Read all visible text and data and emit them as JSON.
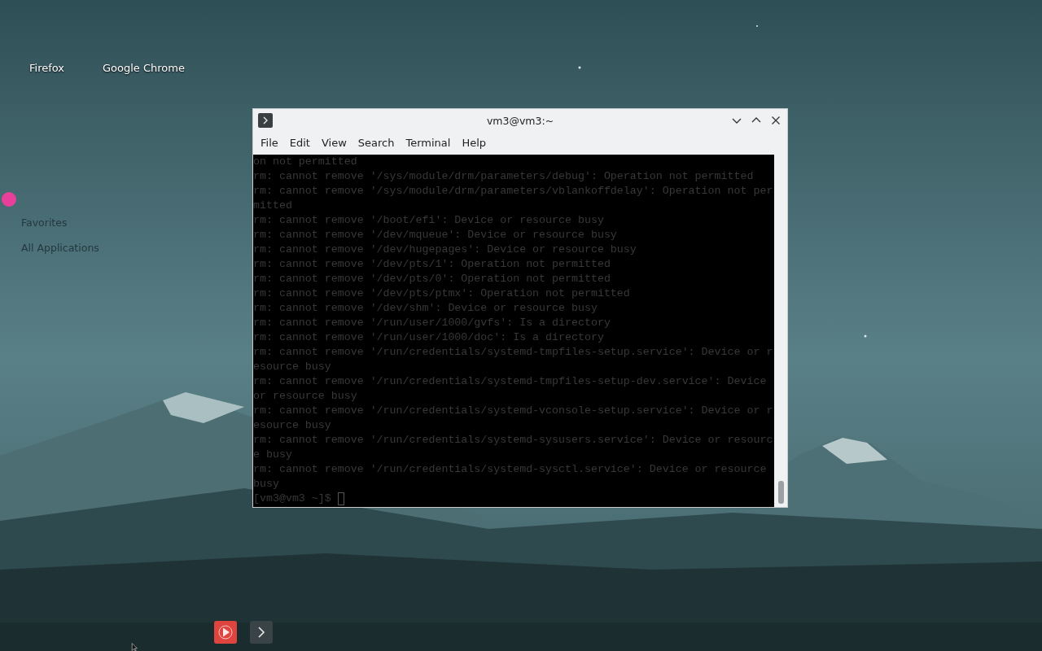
{
  "desktop_icons": [
    {
      "label": "Firefox"
    },
    {
      "label": "Google Chrome"
    }
  ],
  "launcher": {
    "items": [
      {
        "label": "Favorites"
      },
      {
        "label": "All Applications"
      }
    ]
  },
  "window": {
    "title": "vm3@vm3:~",
    "menu": [
      "File",
      "Edit",
      "View",
      "Search",
      "Terminal",
      "Help"
    ],
    "lines": [
      "on not permitted",
      "rm: cannot remove '/sys/module/drm/parameters/debug': Operation not permitted",
      "rm: cannot remove '/sys/module/drm/parameters/vblankoffdelay': Operation not per",
      "mitted",
      "rm: cannot remove '/boot/efi': Device or resource busy",
      "rm: cannot remove '/dev/mqueue': Device or resource busy",
      "rm: cannot remove '/dev/hugepages': Device or resource busy",
      "rm: cannot remove '/dev/pts/1': Operation not permitted",
      "rm: cannot remove '/dev/pts/0': Operation not permitted",
      "rm: cannot remove '/dev/pts/ptmx': Operation not permitted",
      "rm: cannot remove '/dev/shm': Device or resource busy",
      "rm: cannot remove '/run/user/1000/gvfs': Is a directory",
      "rm: cannot remove '/run/user/1000/doc': Is a directory",
      "rm: cannot remove '/run/credentials/systemd-tmpfiles-setup.service': Device or r",
      "esource busy",
      "rm: cannot remove '/run/credentials/systemd-tmpfiles-setup-dev.service': Device",
      "or resource busy",
      "rm: cannot remove '/run/credentials/systemd-vconsole-setup.service': Device or r",
      "esource busy",
      "rm: cannot remove '/run/credentials/systemd-sysusers.service': Device or resourc",
      "e busy",
      "rm: cannot remove '/run/credentials/systemd-sysctl.service': Device or resource",
      "busy"
    ],
    "prompt": "[vm3@vm3 ~]$"
  },
  "taskbar": {
    "items": [
      {
        "kind": "media"
      },
      {
        "kind": "terminal"
      }
    ]
  }
}
